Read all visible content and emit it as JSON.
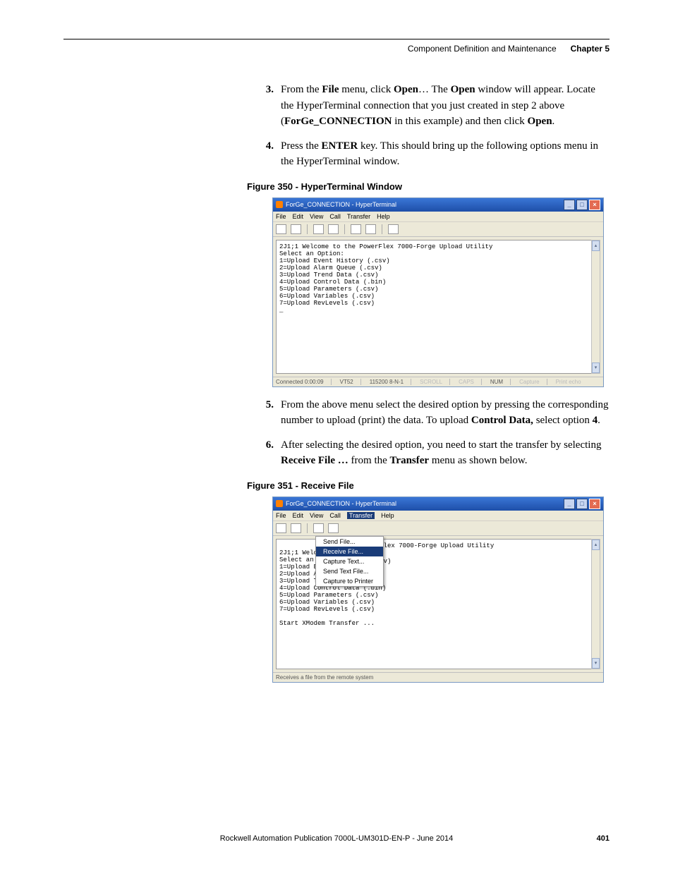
{
  "header": {
    "title": "Component Definition and Maintenance",
    "chapter": "Chapter 5"
  },
  "steps": {
    "s3_num": "3.",
    "s3_a": "From the ",
    "s3_b": "File",
    "s3_c": " menu, click ",
    "s3_d": "Open",
    "s3_e": "… The ",
    "s3_f": "Open",
    "s3_g": " window will appear. Locate the HyperTerminal connection that you just created in step 2 above (",
    "s3_h": "ForGe_CONNECTION",
    "s3_i": " in this example) and then click ",
    "s3_j": "Open",
    "s3_k": ".",
    "s4_num": "4.",
    "s4_a": "Press the ",
    "s4_b": "ENTER",
    "s4_c": " key. This should bring up the following options menu in the HyperTerminal window.",
    "s5_num": "5.",
    "s5_a": "From the above menu select the desired option by pressing the corresponding number to upload (print) the data. To upload ",
    "s5_b": "Control Data,",
    "s5_c": " select option ",
    "s5_d": "4",
    "s5_e": ".",
    "s6_num": "6.",
    "s6_a": "After selecting the desired option, you need to start the transfer by selecting ",
    "s6_b": "Receive File …",
    "s6_c": " from the ",
    "s6_d": "Transfer",
    "s6_e": " menu as shown below."
  },
  "fig350": {
    "caption": "Figure 350 - HyperTerminal Window",
    "title": "ForGe_CONNECTION - HyperTerminal",
    "menu": {
      "file": "File",
      "edit": "Edit",
      "view": "View",
      "call": "Call",
      "transfer": "Transfer",
      "help": "Help"
    },
    "terminal": "2J1;1 Welcome to the PowerFlex 7000-Forge Upload Utility\nSelect an Option:\n1=Upload Event History (.csv)\n2=Upload Alarm Queue (.csv)\n3=Upload Trend Data (.csv)\n4=Upload Control Data (.bin)\n5=Upload Parameters (.csv)\n6=Upload Variables (.csv)\n7=Upload RevLevels (.csv)\n_",
    "status": {
      "conn": "Connected 0:00:09",
      "prot": "VT52",
      "params": "115200 8-N-1",
      "scroll": "SCROLL",
      "caps": "CAPS",
      "num": "NUM",
      "capture": "Capture",
      "print": "Print echo"
    }
  },
  "fig351": {
    "caption": "Figure 351 - Receive File",
    "title": "ForGe_CONNECTION - HyperTerminal",
    "menu": {
      "file": "File",
      "edit": "Edit",
      "view": "View",
      "call": "Call",
      "transfer": "Transfer",
      "help": "Help"
    },
    "dropdown": {
      "send": "Send File...",
      "receive": "Receive File...",
      "captext": "Capture Text...",
      "sendtext": "Send Text File...",
      "capprint": "Capture to Printer"
    },
    "terminal_left": "2J1;1 Welc\nSelect an \n1=Upload E\n2=Upload Alarm Queue (.csv)\n3=Upload Trend Data (.csv)\n4=Upload Control Data (.bin)\n5=Upload Parameters (.csv)\n6=Upload Variables (.csv)\n7=Upload RevLevels (.csv)\n\nStart XModem Transfer ...",
    "terminal_right_a": "werFlex 7000-Forge Upload Utility",
    "terminal_right_b": "(.csv)",
    "status": "Receives a file from the remote system"
  },
  "footer": {
    "pub": "Rockwell Automation Publication 7000L-UM301D-EN-P - June 2014",
    "page": "401"
  }
}
